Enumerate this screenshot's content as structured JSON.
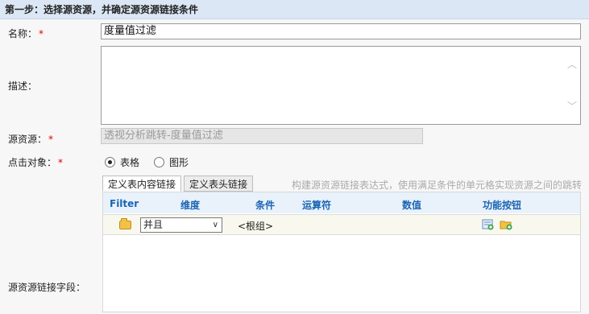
{
  "header": {
    "title": "第一步：选择源资源，并确定源资源链接条件"
  },
  "form": {
    "name_label": "名称：",
    "name_value": "度量值过滤",
    "desc_label": "描述：",
    "source_label": "源资源：",
    "source_value": "透视分析跳转-度量值过滤",
    "click_label": "点击对象：",
    "radio_options": [
      "表格",
      "图形"
    ],
    "selected_radio": "表格",
    "fields_label": "源资源链接字段："
  },
  "tabs": [
    "定义表内容链接",
    "定义表头链接"
  ],
  "active_tab": "定义表内容链接",
  "hint": "构建源资源链接表达式，使用满足条件的单元格实现资源之间的跳转",
  "grid": {
    "columns": [
      "Filter",
      "维度",
      "条件",
      "运算符",
      "数值",
      "功能按钮"
    ],
    "row": {
      "logic_value": "并且",
      "group_text": "<根组>"
    }
  },
  "colors": {
    "required": "#dd0000",
    "header_bg": "#dbe7f4",
    "column_header": "#1b64b3"
  },
  "icons": [
    "folder-icon",
    "chevron-down-icon",
    "add-condition-icon",
    "add-group-icon",
    "scroll-up-icon",
    "scroll-down-icon"
  ]
}
